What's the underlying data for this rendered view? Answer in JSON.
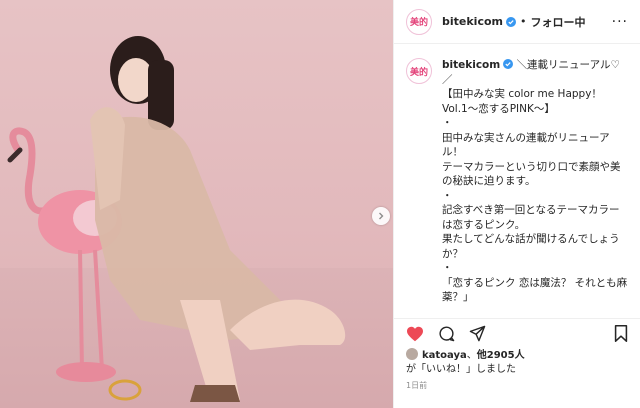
{
  "post": {
    "account": {
      "avatar_text": "美的",
      "handle": "bitekicom",
      "follow_state": "フォロー中",
      "dot": "•"
    },
    "caption": {
      "user": "bitekicom",
      "text": "＼連載リニューアル♡／\n【田中みな実 color me Happy！ Vol.1〜恋するPINK〜】\n・\n田中みな実さんの連載がリニューアル！\nテーマカラーという切り口で素顔や美の秘訣に迫ります。\n・\n記念すべき第一回となるテーマカラーは恋するピンク。\n果たしてどんな話が聞けるんでしょうか？\n・\n「恋するピンク 恋は魔法？ それとも麻薬？」\n・\nピンクがもつイメージは、月並みだけど恋だと思う。"
    },
    "likes": {
      "user": "katoaya",
      "others": "他2905人",
      "tail": "が「いいね！」しました"
    },
    "time": "1日前"
  },
  "colors": {
    "accent_like": "#ed4956",
    "brand_pink": "#e3437a",
    "verified_blue": "#3897f0",
    "photo_bg": "#e4bcbf"
  },
  "icons": {
    "like": "heart-filled-icon",
    "comment": "comment-icon",
    "share": "paper-plane-icon",
    "save": "bookmark-icon",
    "next": "chevron-right-icon",
    "verified": "verified-badge-icon",
    "more": "more-options-icon"
  }
}
